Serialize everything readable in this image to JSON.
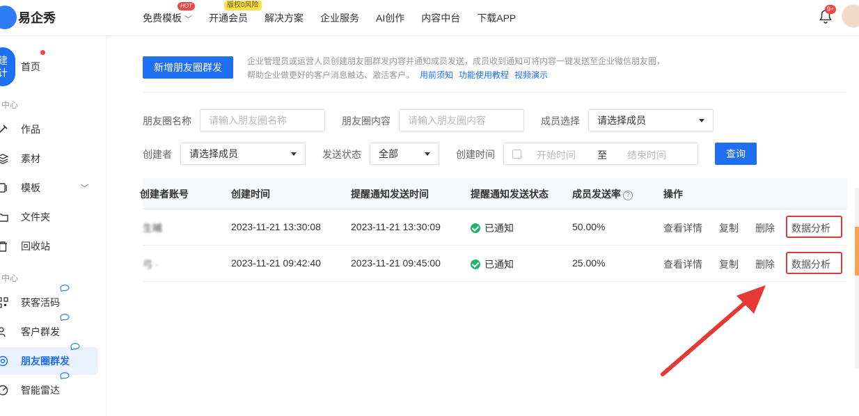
{
  "app": {
    "name": "易企秀"
  },
  "nav": {
    "items": [
      {
        "label": "免费模板",
        "has_chevron": true,
        "badge": "HOT"
      },
      {
        "label": "开通会员",
        "badge": "版权0风险"
      },
      {
        "label": "解决方案"
      },
      {
        "label": "企业服务"
      },
      {
        "label": "AI创作"
      },
      {
        "label": "内容中台"
      },
      {
        "label": "下载APP"
      }
    ],
    "notification_count": "9+"
  },
  "sidebar": {
    "create_label": "建\n计",
    "home": "首页",
    "section1": "中心",
    "section2": "中心",
    "items1": [
      "作品",
      "素材",
      "模板",
      "文件夹",
      "回收站"
    ],
    "items2": [
      "获客活码",
      "客户群发",
      "朋友圈群发",
      "智能雷达"
    ],
    "active": "朋友圈群发"
  },
  "main": {
    "add_button": "新增朋友圈群发",
    "desc_line1": "企业管理员或运营人员创建朋友圈群发内容并通知成员发送，成员收到通知可将内容一键发送至企业微信朋友圈，",
    "desc_line2": "帮助企业做更好的客户消息触达、激活客户。",
    "links": [
      "用前须知",
      "功能使用教程",
      "视频演示"
    ]
  },
  "filters": {
    "name_label": "朋友圈名称",
    "name_placeholder": "请输入朋友圈名称",
    "content_label": "朋友圈内容",
    "content_placeholder": "请输入朋友圈内容",
    "member_label": "成员选择",
    "member_value": "请选择成员",
    "creator_label": "创建者",
    "creator_value": "请选择成员",
    "status_label": "发送状态",
    "status_value": "全部",
    "time_label": "创建时间",
    "start_placeholder": "开始时间",
    "to": "至",
    "end_placeholder": "结束时间",
    "query": "查询"
  },
  "table": {
    "headers": [
      "创建者账号",
      "创建时间",
      "提醒通知发送时间",
      "提醒通知发送状态",
      "成员发送率",
      "操作"
    ],
    "rows": [
      {
        "account": "生晡",
        "created": "2023-11-21 13:30:08",
        "notify_time": "2023-11-21 13:30:09",
        "status": "已通知",
        "rate": "50.00%"
      },
      {
        "account": "弓 ·",
        "created": "2023-11-21 09:42:40",
        "notify_time": "2023-11-21 09:45:00",
        "status": "已通知",
        "rate": "25.00%"
      }
    ],
    "actions": [
      "查看详情",
      "复制",
      "删除",
      "数据分析"
    ]
  }
}
